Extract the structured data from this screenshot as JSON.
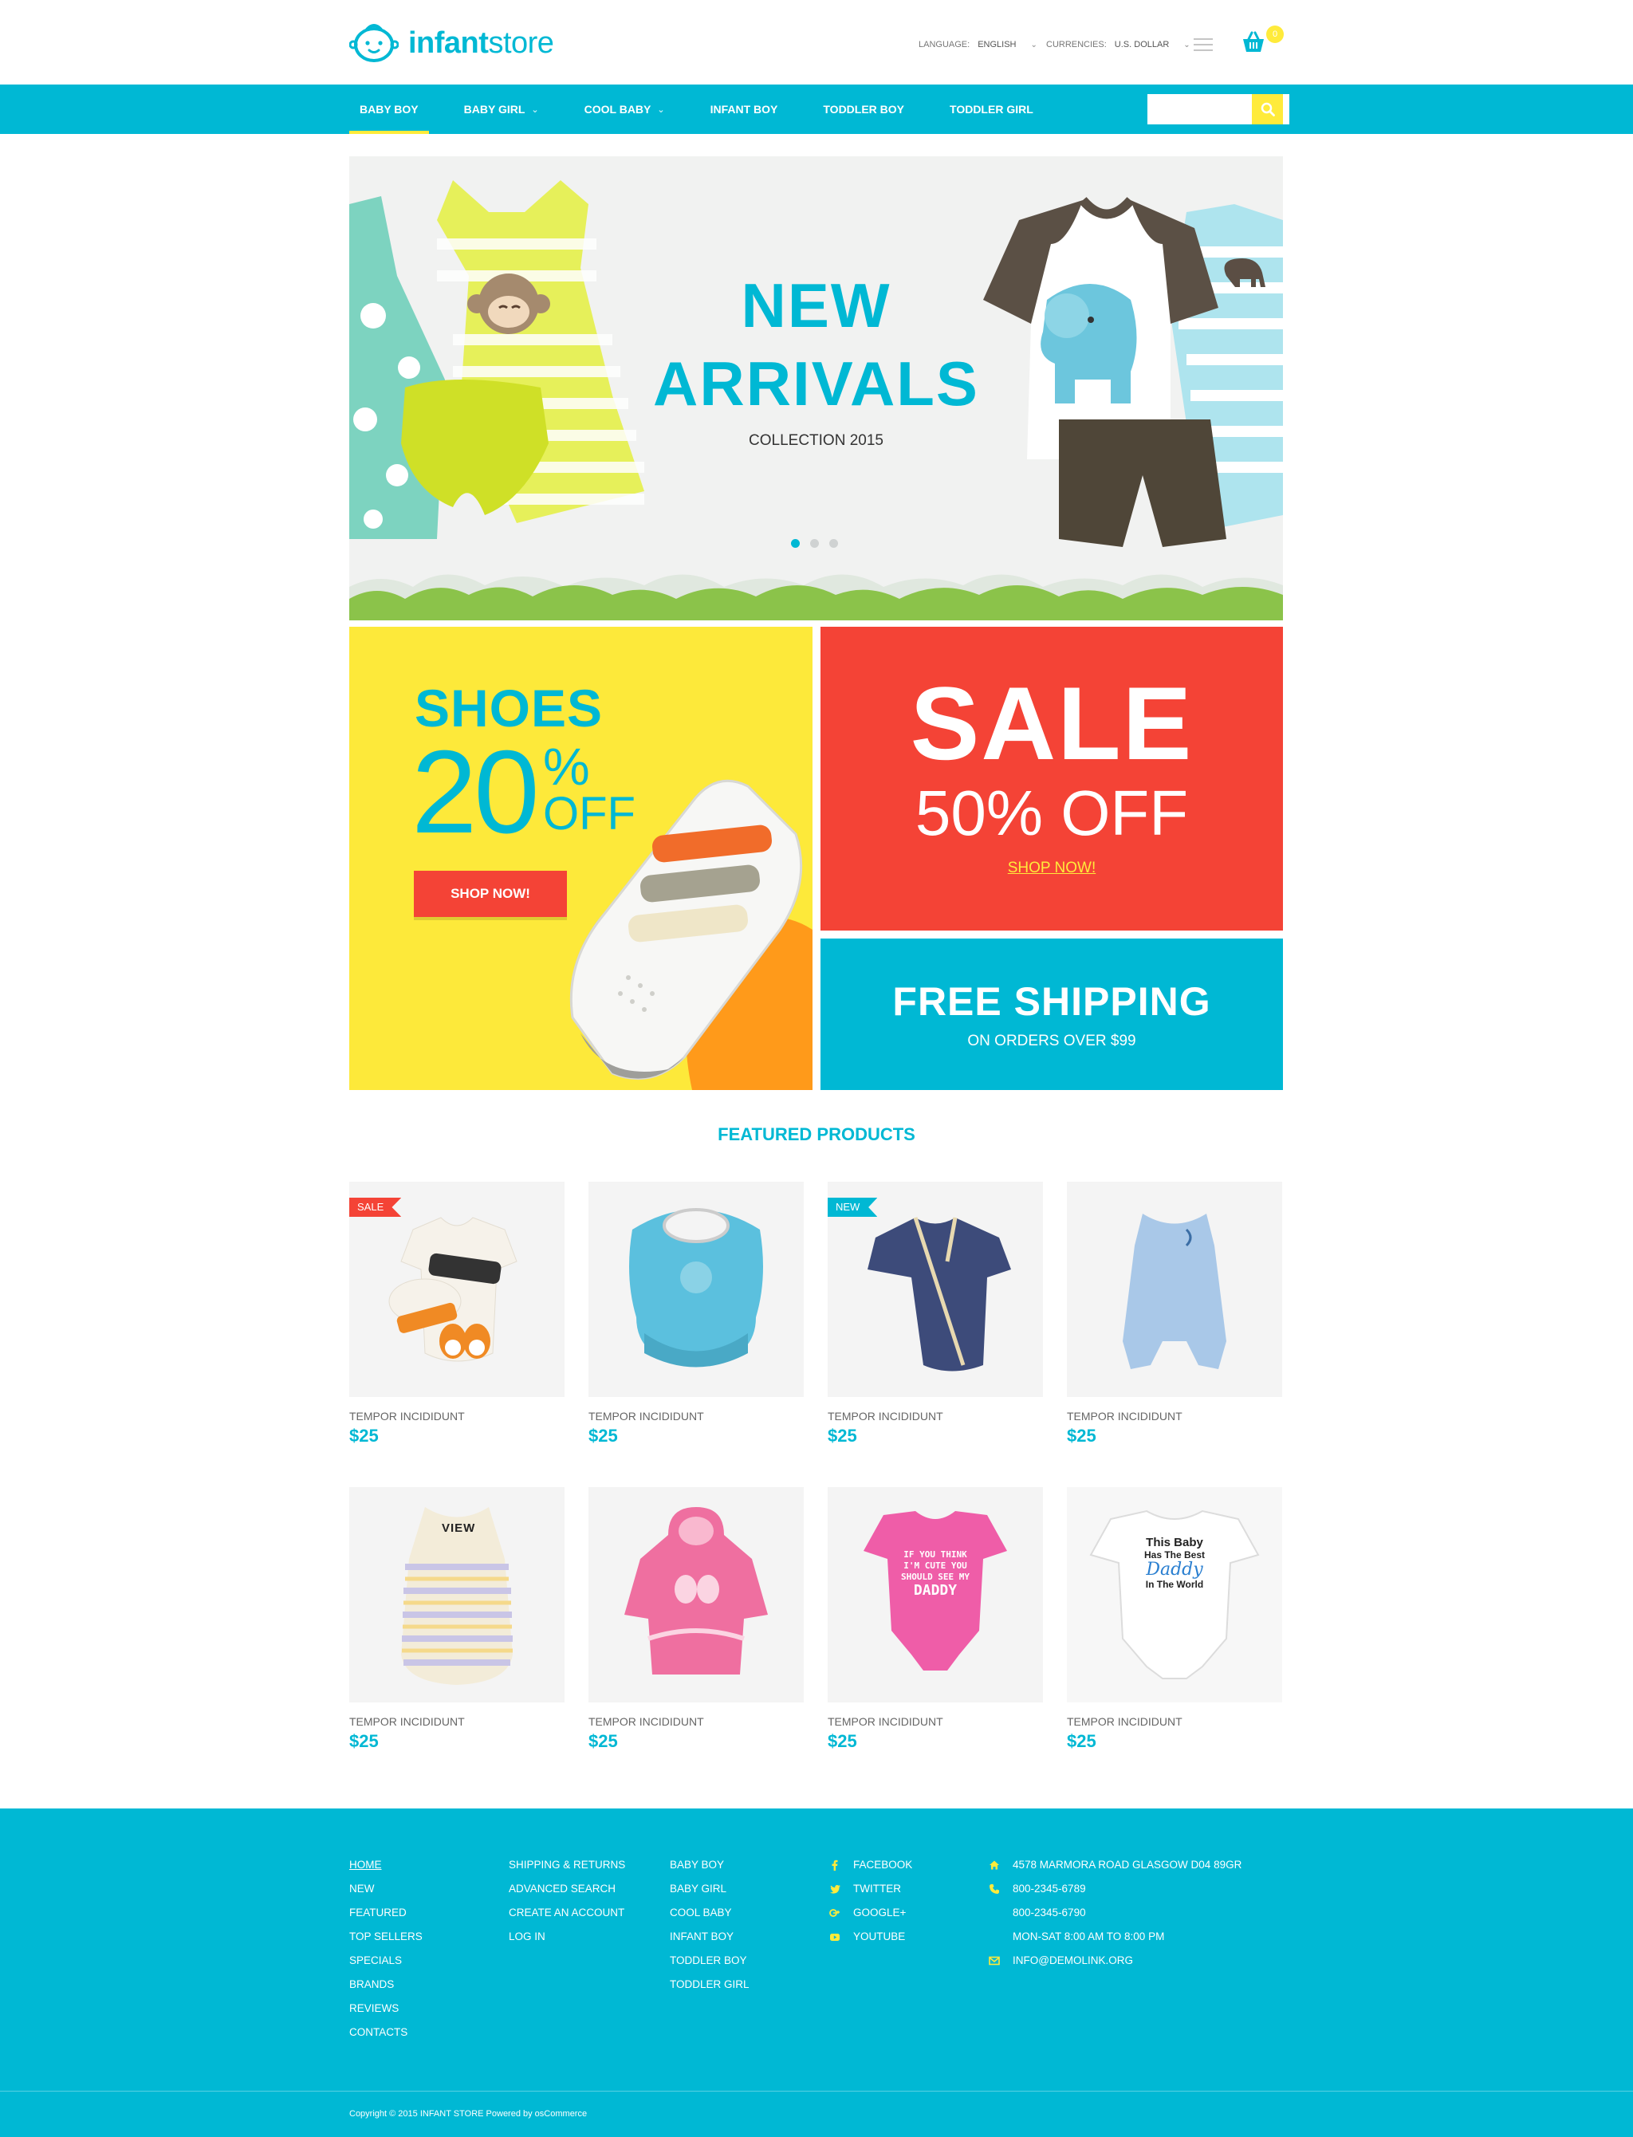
{
  "header": {
    "logo_bold": "infant",
    "logo_light": "store",
    "language_label": "LANGUAGE:",
    "language_value": "ENGLISH",
    "currencies_label": "CURRENCIES:",
    "currency_value": "U.S. DOLLAR",
    "cart_count": "0"
  },
  "nav": {
    "items": [
      {
        "label": "BABY BOY"
      },
      {
        "label": "BABY GIRL"
      },
      {
        "label": "COOL BABY"
      },
      {
        "label": "INFANT BOY"
      },
      {
        "label": "TODDLER BOY"
      },
      {
        "label": "TODDLER GIRL"
      }
    ],
    "search_value": ""
  },
  "slider": {
    "title_line1": "NEW",
    "title_line2": "ARRIVALS",
    "subtitle": "COLLECTION 2015",
    "active_dot": 1,
    "dot_count": 3
  },
  "banners": {
    "shoes": {
      "title": "SHOES",
      "number": "20",
      "percent": "%",
      "off": "OFF",
      "button": "SHOP NOW!"
    },
    "sale": {
      "title": "SALE",
      "off": "50% OFF",
      "link": "SHOP NOW!"
    },
    "shipping": {
      "title": "FREE SHIPPING",
      "subtitle": "ON ORDERS OVER $99"
    }
  },
  "featured": {
    "title": "FEATURED PRODUCTS",
    "view_label": "VIEW",
    "products": [
      {
        "name": "TEMPOR INCIDIDUNT",
        "price": "$25",
        "badge": "SALE",
        "image": "jordan-onesie-set"
      },
      {
        "name": "TEMPOR INCIDIDUNT",
        "price": "$25",
        "badge": "",
        "image": "blue-bib"
      },
      {
        "name": "TEMPOR INCIDIDUNT",
        "price": "$25",
        "badge": "NEW",
        "image": "navy-sleeper"
      },
      {
        "name": "TEMPOR INCIDIDUNT",
        "price": "$25",
        "badge": "",
        "image": "light-blue-sleep-sack"
      },
      {
        "name": "TEMPOR INCIDIDUNT",
        "price": "$25",
        "badge": "",
        "image": "striped-sleep-sack"
      },
      {
        "name": "TEMPOR INCIDIDUNT",
        "price": "$25",
        "badge": "",
        "image": "pink-robe"
      },
      {
        "name": "TEMPOR INCIDIDUNT",
        "price": "$25",
        "badge": "",
        "image": "pink-onesie",
        "print": [
          "IF YOU THINK",
          "I'M CUTE YOU",
          "SHOULD SEE MY",
          "DADDY"
        ]
      },
      {
        "name": "TEMPOR INCIDIDUNT",
        "price": "$25",
        "badge": "",
        "image": "white-onesie",
        "print": [
          "This Baby",
          "Has The Best",
          "Daddy",
          "In The World"
        ]
      }
    ]
  },
  "footer": {
    "col1": [
      "HOME",
      "NEW",
      "FEATURED",
      "TOP SELLERS",
      "SPECIALS",
      "BRANDS",
      "REVIEWS",
      "CONTACTS"
    ],
    "col2": [
      "SHIPPING & RETURNS",
      "ADVANCED SEARCH",
      "CREATE AN ACCOUNT",
      "LOG IN"
    ],
    "col3": [
      "BABY BOY",
      "BABY GIRL",
      "COOL BABY",
      "INFANT BOY",
      "TODDLER BOY",
      "TODDLER GIRL"
    ],
    "social": [
      {
        "label": "FACEBOOK",
        "icon": "facebook-icon"
      },
      {
        "label": "TWITTER",
        "icon": "twitter-icon"
      },
      {
        "label": "GOOGLE+",
        "icon": "google-plus-icon"
      },
      {
        "label": "YOUTUBE",
        "icon": "youtube-icon"
      }
    ],
    "contact": {
      "address": "4578 MARMORA ROAD GLASGOW D04 89GR",
      "phone1": "800-2345-6789",
      "phone2": "800-2345-6790",
      "hours": "MON-SAT 8:00 AM TO 8:00 PM",
      "email": "INFO@DEMOLINK.ORG"
    },
    "copyright": "Copyright © 2015 INFANT STORE Powered by osCommerce"
  },
  "colors": {
    "accent": "#00b8d4",
    "yellow": "#fde93a",
    "red": "#f44336"
  }
}
